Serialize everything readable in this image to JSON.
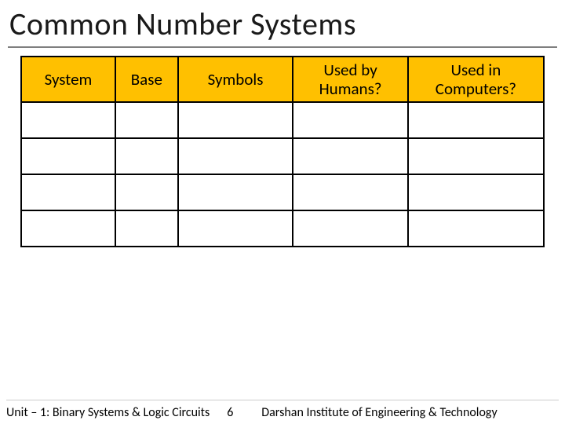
{
  "title": "Common Number Systems",
  "table": {
    "headers": {
      "col1": "System",
      "col2": "Base",
      "col3": "Symbols",
      "col4": "Used by Humans?",
      "col5": "Used in Computers?"
    },
    "rows": [
      {
        "system": "",
        "base": "",
        "symbols": "",
        "humans": "",
        "computers": ""
      },
      {
        "system": "",
        "base": "",
        "symbols": "",
        "humans": "",
        "computers": ""
      },
      {
        "system": "",
        "base": "",
        "symbols": "",
        "humans": "",
        "computers": ""
      },
      {
        "system": "",
        "base": "",
        "symbols": "",
        "humans": "",
        "computers": ""
      }
    ]
  },
  "footer": {
    "unit": "Unit – 1: Binary Systems & Logic Circuits",
    "page": "6",
    "org": "Darshan Institute of Engineering & Technology"
  }
}
